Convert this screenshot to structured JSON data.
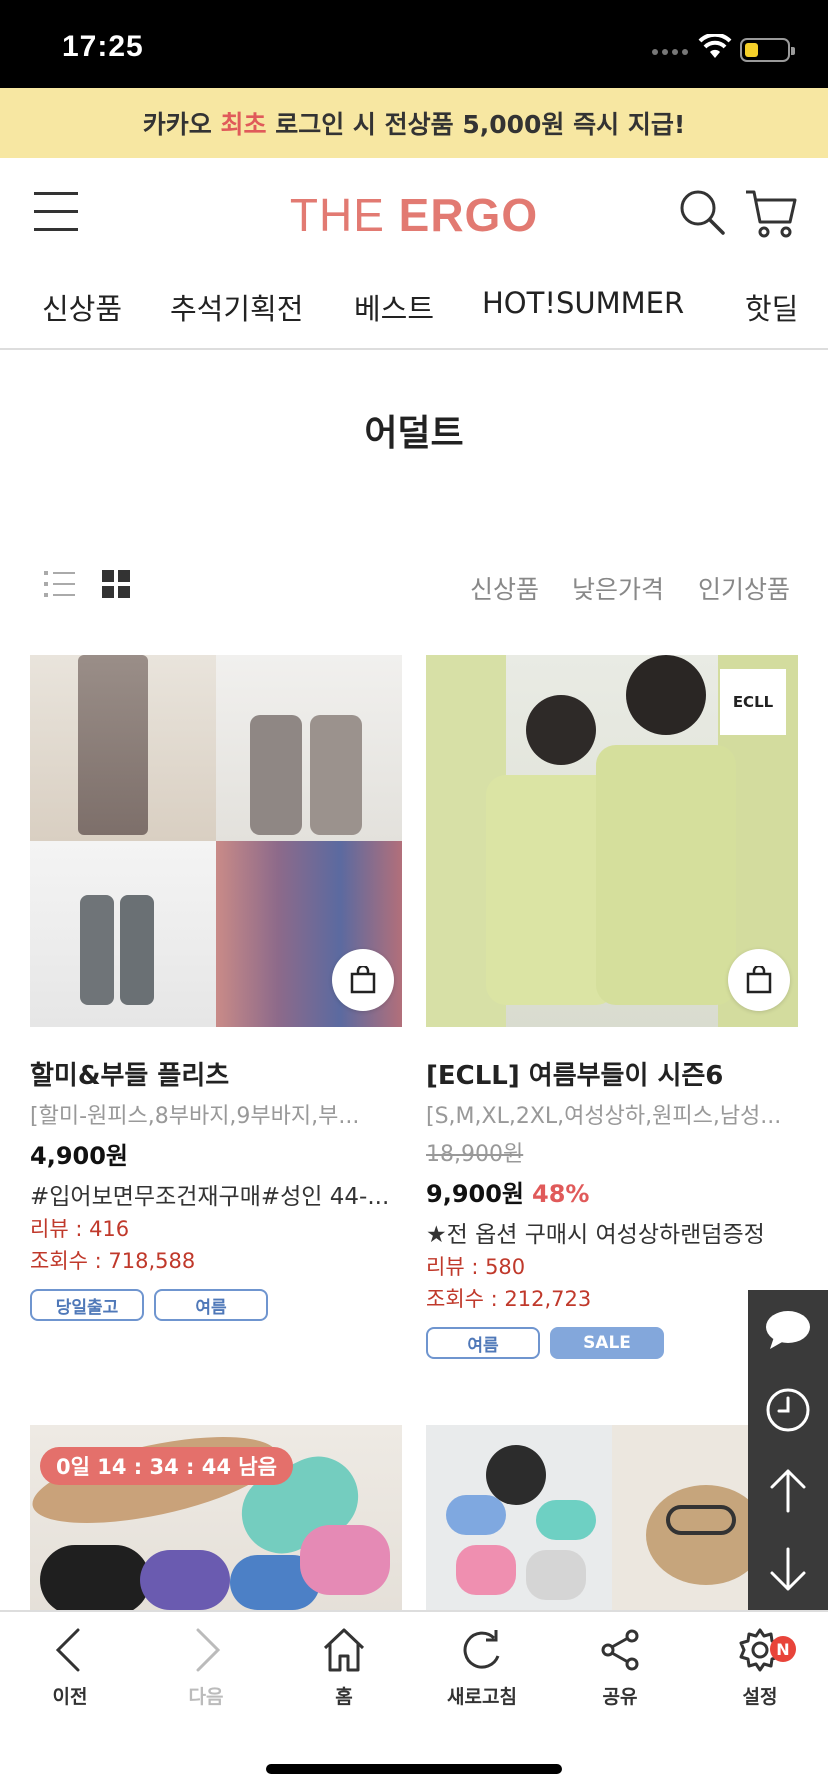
{
  "status_bar": {
    "time": "17:25"
  },
  "promo": {
    "prefix": "카카오 ",
    "highlight": "최초",
    "suffix": " 로그인 시 전상품 5,000원 즉시 지급!"
  },
  "header": {
    "logo_light": "THE ",
    "logo_bold": "ERGO"
  },
  "nav": {
    "items": [
      "신상품",
      "추석기획전",
      "베스트",
      "HOT!SUMMER",
      "핫딜"
    ]
  },
  "page": {
    "title": "어덜트"
  },
  "sort": {
    "options": [
      "신상품",
      "낮은가격",
      "인기상품"
    ]
  },
  "products": [
    {
      "name": "할미&부들 플리츠",
      "options": "[할미-원피스,8부바지,9부바지,부...",
      "price": "4,900원",
      "desc": "#입어보면무조건재구매#성인 44-...",
      "reviews": "리뷰 : 416",
      "views": "조회수 : 718,588",
      "tags": [
        "당일출고",
        "여름"
      ]
    },
    {
      "name": "[ECLL] 여름부들이 시즌6",
      "options": "[S,M,XL,2XL,여성상하,원피스,남성...",
      "original_price": "18,900원",
      "price": "9,900원",
      "discount": "48%",
      "desc": "★전 옵션 구매시 여성상하랜덤증정",
      "reviews": "리뷰 : 580",
      "views": "조회수 : 212,723",
      "tags": [
        "여름",
        "SALE"
      ],
      "image_label": "ECLL"
    },
    {
      "timer": "0일 14 : 34 : 44 남음"
    }
  ],
  "bottom_bar": {
    "items": [
      "이전",
      "다음",
      "홈",
      "새로고침",
      "공유",
      "설정"
    ],
    "badge": "N"
  },
  "colors": {
    "accent": "#e27a72",
    "promo_bg": "#f7e7a2",
    "sale": "#e05a5a",
    "tag": "#4f78b8"
  }
}
